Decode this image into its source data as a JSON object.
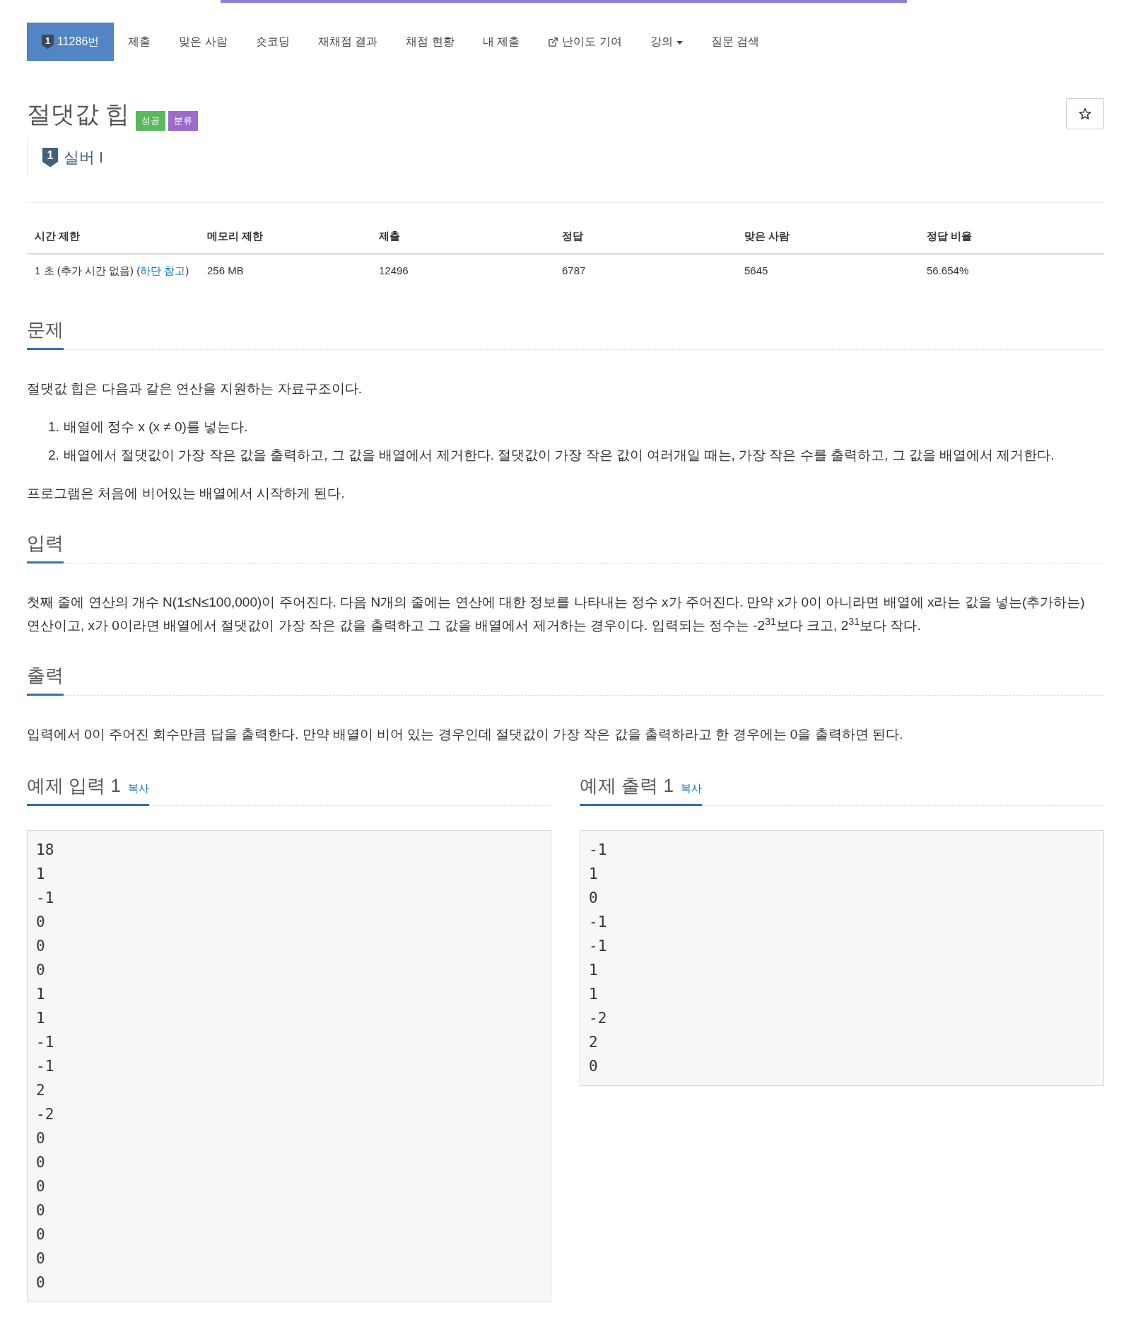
{
  "nav": {
    "tabs": [
      {
        "kind": "problem",
        "tier": "1",
        "label": "11286번",
        "selected": true
      },
      {
        "kind": "link",
        "label": "제출",
        "selected": false
      },
      {
        "kind": "link",
        "label": "맞은 사람",
        "selected": false
      },
      {
        "kind": "link",
        "label": "숏코딩",
        "selected": false
      },
      {
        "kind": "link",
        "label": "재채점 결과",
        "selected": false
      },
      {
        "kind": "link",
        "label": "채점 현황",
        "selected": false
      },
      {
        "kind": "link",
        "label": "내 제출",
        "selected": false
      },
      {
        "kind": "external",
        "label": "난이도 기여",
        "selected": false
      },
      {
        "kind": "dropdown",
        "label": "강의",
        "selected": false
      },
      {
        "kind": "link",
        "label": "질문 검색",
        "selected": false
      }
    ]
  },
  "problem": {
    "title": "절댓값 힙",
    "labels": [
      {
        "text": "성공",
        "color": "#5cb85c"
      },
      {
        "text": "분류",
        "color": "#9b6bcc"
      }
    ],
    "tier": {
      "digit": "1",
      "name": "실버 I"
    }
  },
  "limits": {
    "columns": [
      "시간 제한",
      "메모리 제한",
      "제출",
      "정답",
      "맞은 사람",
      "정답 비율"
    ],
    "rows": [
      [
        {
          "text": "1 초 (추가 시간 없음) (",
          "link": "하단 참고",
          "after": ")"
        },
        {
          "text": "256 MB"
        },
        {
          "text": "12496"
        },
        {
          "text": "6787"
        },
        {
          "text": "5645"
        },
        {
          "text": "56.654%"
        }
      ]
    ]
  },
  "sections": [
    {
      "heading": "문제",
      "blocks": [
        {
          "kind": "paragraph",
          "text": "절댓값 힙은 다음과 같은 연산을 지원하는 자료구조이다."
        },
        {
          "kind": "list",
          "items": [
            {
              "marker": "1.",
              "text": "배열에 정수 x (x ≠ 0)를 넣는다."
            },
            {
              "marker": "2.",
              "text": "배열에서 절댓값이 가장 작은 값을 출력하고, 그 값을 배열에서 제거한다. 절댓값이 가장 작은 값이 여러개일 때는, 가장 작은 수를 출력하고, 그 값을 배열에서 제거한다."
            }
          ]
        },
        {
          "kind": "paragraph",
          "text": "프로그램은 처음에 비어있는 배열에서 시작하게 된다."
        }
      ]
    },
    {
      "heading": "입력",
      "blocks": [
        {
          "kind": "paragraph",
          "text": "첫째 줄에 연산의 개수 N(1≤N≤100,000)이 주어진다. 다음 N개의 줄에는 연산에 대한 정보를 나타내는 정수 x가 주어진다. 만약 x가 0이 아니라면 배열에 x라는 값을 넣는(추가하는) 연산이고, x가 0이라면 배열에서 절댓값이 가장 작은 값을 출력하고 그 값을 배열에서 제거하는 경우이다. 입력되는 정수는 -2$^{31}$보다 크고, 2$^{31}$보다 작다."
        }
      ]
    },
    {
      "heading": "출력",
      "blocks": [
        {
          "kind": "paragraph",
          "text": "입력에서 0이 주어진 회수만큼 답을 출력한다. 만약 배열이 비어 있는 경우인데 절댓값이 가장 작은 값을 출력하라고 한 경우에는 0을 출력하면 된다."
        }
      ]
    }
  ],
  "samples": [
    {
      "title": "예제 입력 1",
      "copy": "복사",
      "content": "18\n1\n-1\n0\n0\n0\n1\n1\n-1\n-1\n2\n-2\n0\n0\n0\n0\n0\n0\n0"
    },
    {
      "title": "예제 출력 1",
      "copy": "복사",
      "content": "-1\n1\n0\n-1\n-1\n1\n1\n-2\n2\n0"
    }
  ]
}
